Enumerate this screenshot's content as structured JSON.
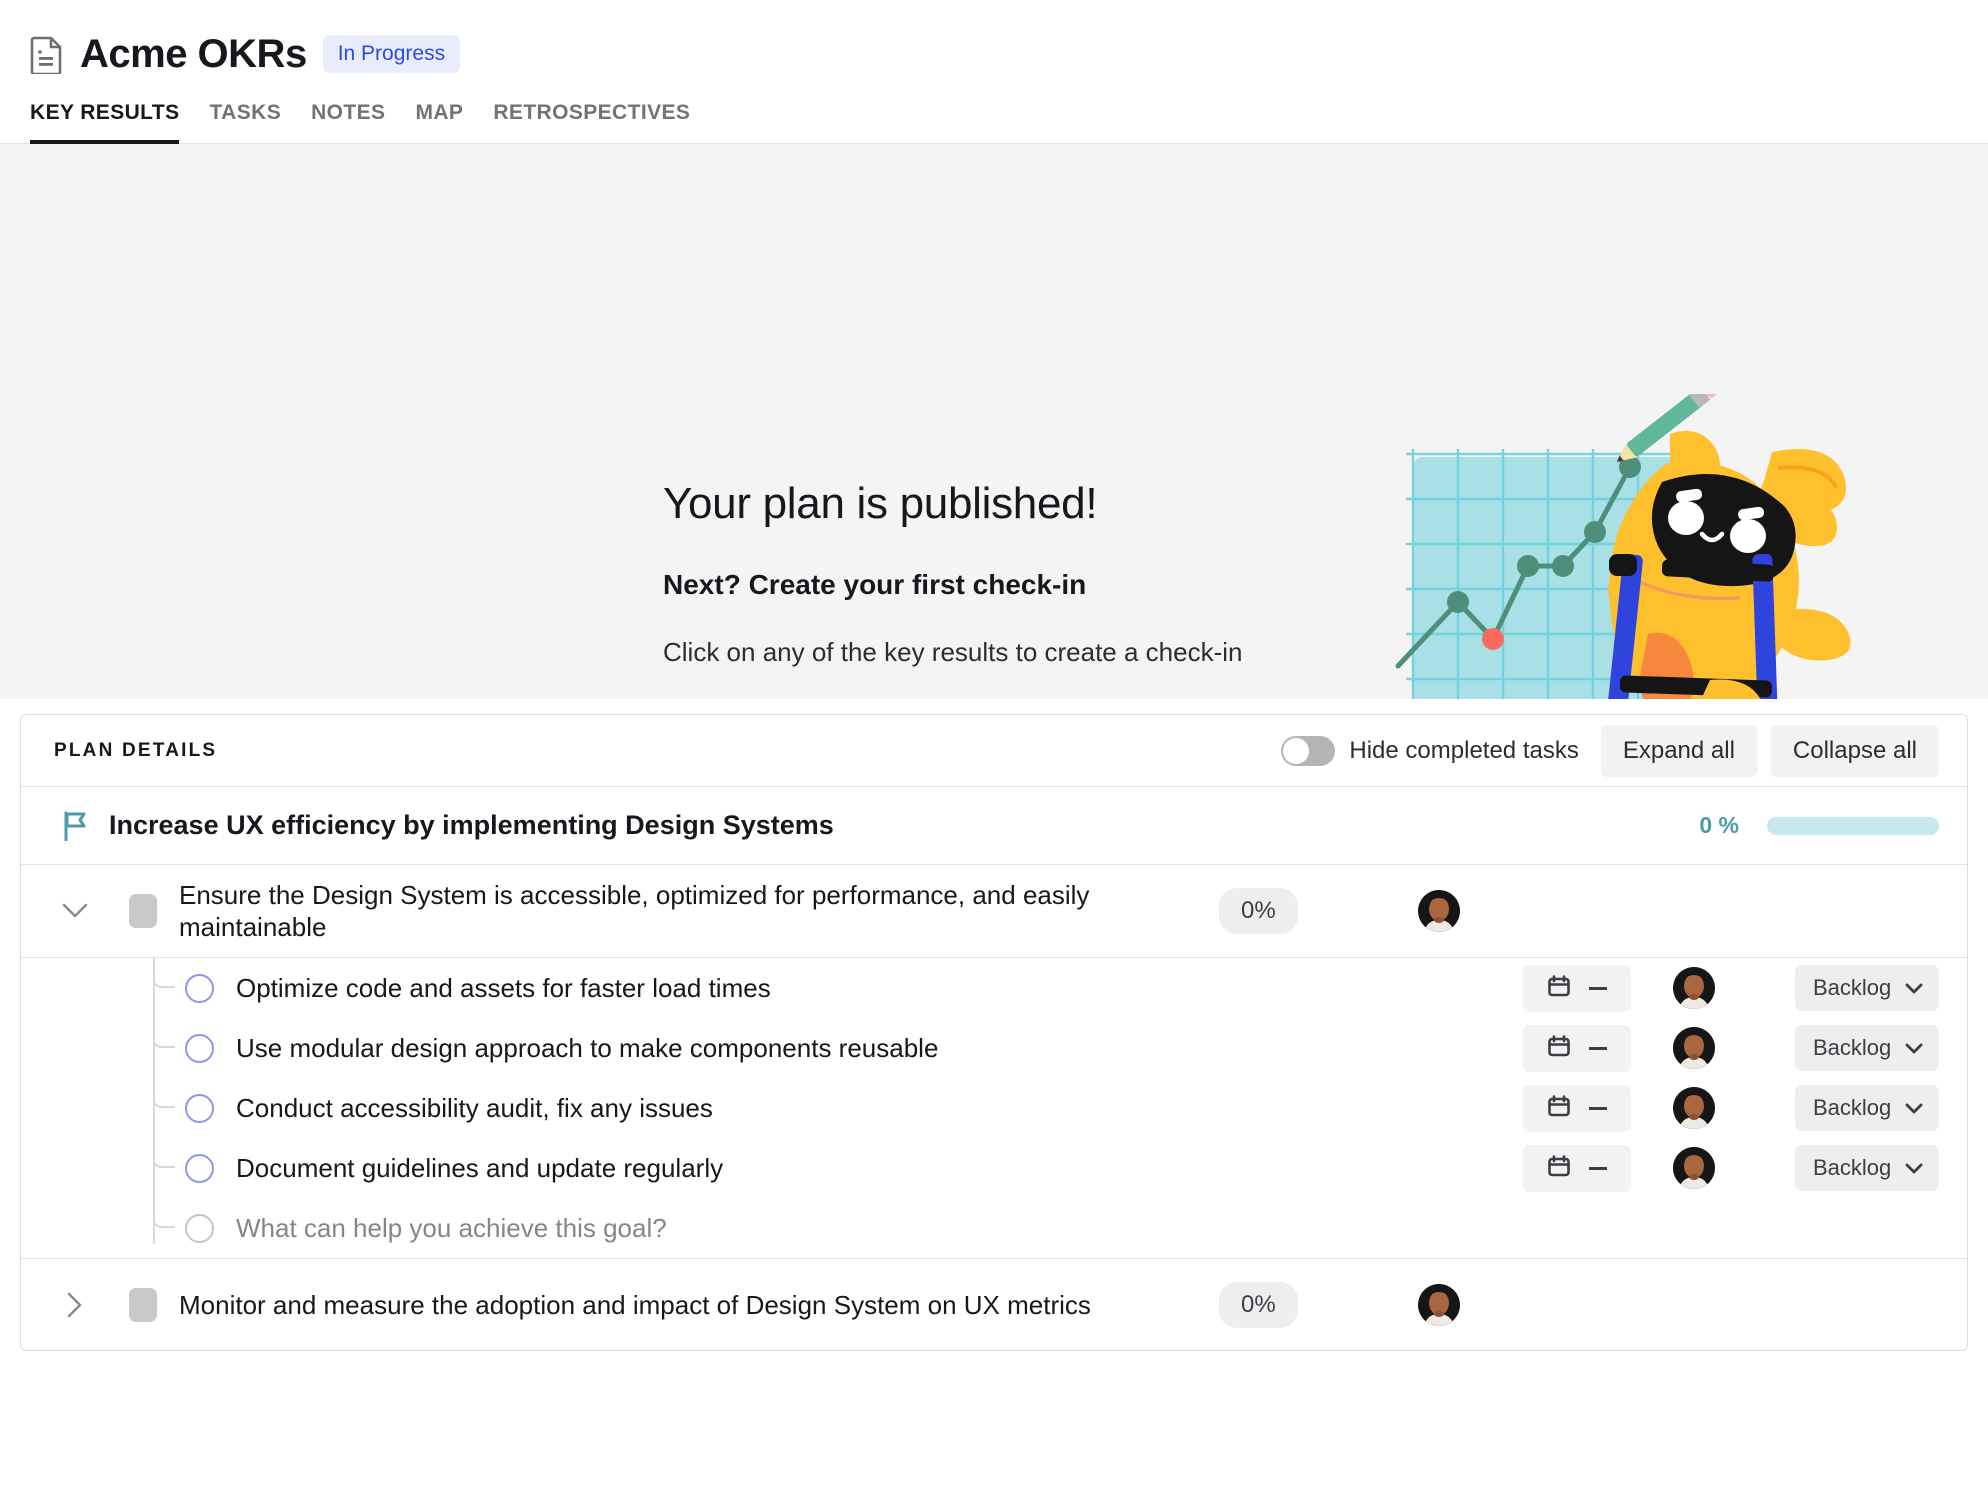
{
  "header": {
    "doc_icon": "document-icon",
    "title": "Acme OKRs",
    "status_badge": "In Progress"
  },
  "tabs": [
    {
      "label": "KEY RESULTS",
      "active": true
    },
    {
      "label": "TASKS",
      "active": false
    },
    {
      "label": "NOTES",
      "active": false
    },
    {
      "label": "MAP",
      "active": false
    },
    {
      "label": "RETROSPECTIVES",
      "active": false
    }
  ],
  "hero": {
    "title": "Your plan is published!",
    "subtitle": "Next? Create your first check-in",
    "description": "Click on any of the key results to create a check-in",
    "illustration": "mascot-drawing-chart-on-ladder-illustration"
  },
  "plan_details": {
    "section_label": "PLAN DETAILS",
    "hide_completed_label": "Hide completed tasks",
    "hide_completed_on": false,
    "expand_all_label": "Expand all",
    "collapse_all_label": "Collapse all"
  },
  "objective": {
    "icon": "flag-icon",
    "title": "Increase UX efficiency by implementing Design Systems",
    "progress_label": "0 %",
    "progress_value": 0,
    "bar_color": "#c7e8ee",
    "text_color": "#4f9aa8"
  },
  "key_results": [
    {
      "title": "Ensure the Design System is accessible, optimized for performance, and easily maintainable",
      "progress_label": "0%",
      "expanded": true,
      "chevron": "chevron-down-icon",
      "tasks": [
        {
          "label": "Optimize code and assets for faster load times",
          "date_value": "—",
          "status": "Backlog",
          "placeholder": false
        },
        {
          "label": "Use modular design approach to make components reusable",
          "date_value": "—",
          "status": "Backlog",
          "placeholder": false
        },
        {
          "label": "Conduct accessibility audit, fix any issues",
          "date_value": "—",
          "status": "Backlog",
          "placeholder": false
        },
        {
          "label": "Document guidelines and update regularly",
          "date_value": "—",
          "status": "Backlog",
          "placeholder": false
        },
        {
          "label": "What can help you achieve this goal?",
          "date_value": "",
          "status": "",
          "placeholder": true
        }
      ]
    },
    {
      "title": "Monitor and measure the adoption and impact of Design System on UX metrics",
      "progress_label": "0%",
      "expanded": false,
      "chevron": "chevron-right-icon",
      "tasks": []
    }
  ],
  "colors": {
    "accent_blue": "#2f4ae0",
    "badge_bg": "#e8ecfb",
    "teal": "#4f9aa8",
    "teal_light": "#c7e8ee",
    "checkbox_purple": "#8f96e8",
    "hero_bg": "#f4f4f4"
  }
}
